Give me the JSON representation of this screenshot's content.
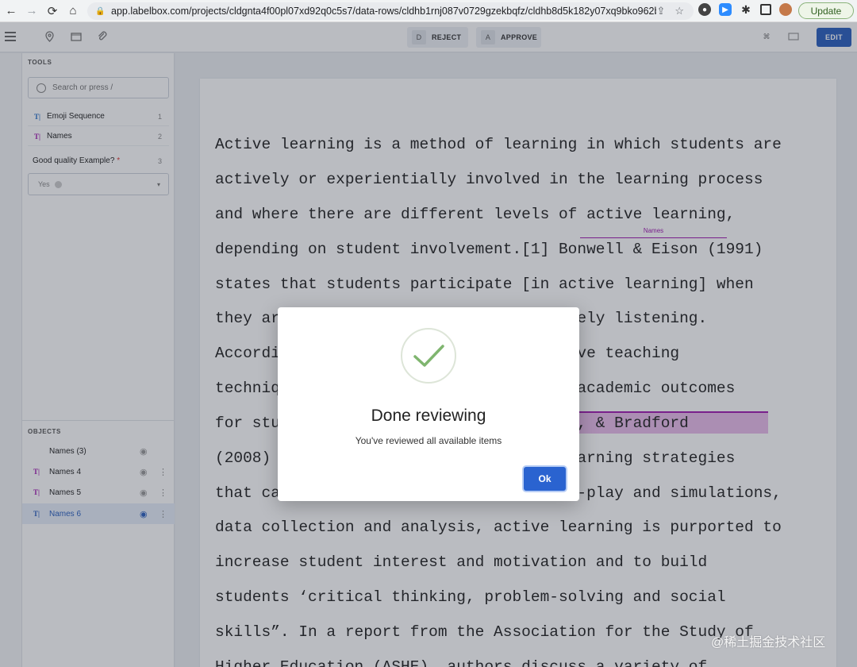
{
  "browser": {
    "url": "app.labelbox.com/projects/cldgnta4f00pl07xd92q0c5s7/data-rows/cldhb1rnj087v0729gzekbqfz/cldhb8d5k182y07xq9bko962b...",
    "update_label": "Update"
  },
  "header": {
    "reject_key": "D",
    "reject_label": "REJECT",
    "approve_key": "A",
    "approve_label": "APPROVE",
    "edit_label": "EDIT"
  },
  "sidebar": {
    "tools_label": "TOOLS",
    "search_placeholder": "Search or press /",
    "tools": [
      {
        "icon": "T|",
        "label": "Emoji Sequence",
        "key": "1",
        "color": "#2a72c9"
      },
      {
        "icon": "T|",
        "label": "Names",
        "key": "2",
        "color": "#a01ab0"
      }
    ],
    "question": {
      "label": "Good quality Example?",
      "required_mark": "*",
      "key": "3",
      "selected": "Yes"
    },
    "objects_label": "OBJECTS",
    "objects": [
      {
        "label": "Names (3)",
        "icon": "",
        "color": "#222"
      },
      {
        "label": "Names 4",
        "icon": "T|",
        "color": "#a01ab0"
      },
      {
        "label": "Names 5",
        "icon": "T|",
        "color": "#a01ab0"
      },
      {
        "label": "Names 6",
        "icon": "T|",
        "color": "#2a5fbf"
      }
    ]
  },
  "document": {
    "lines": [
      "Active learning is a method of learning in which students are",
      "actively or experientially involved in the learning process",
      "and where there are different levels of active learning,",
      "depending on student involvement.[1] Bonwell & Eison (1991)",
      "states that students participate [in active learning] when",
      "they are doing something besides passively listening.",
      "According to a recent study, using active teaching",
      "techniques has shown to achieve better academic outcomes",
      "for students as stated by McCarthy, Liu, & Bradford",
      "(2008) where they discuss that using learning strategies",
      "that can include small-group work, role-play and simulations,",
      "data collection and analysis, active learning is purported to",
      "increase student interest and motivation and to build",
      "students ‘critical thinking, problem-solving and social",
      "skills”. In a report from the Association for the Study of",
      "Higher Education (ASHE), authors discuss a variety of"
    ],
    "annotation_tag": "Names"
  },
  "modal": {
    "title": "Done reviewing",
    "message": "You've reviewed all available items",
    "ok_label": "Ok"
  },
  "watermark": "@稀土掘金技术社区"
}
